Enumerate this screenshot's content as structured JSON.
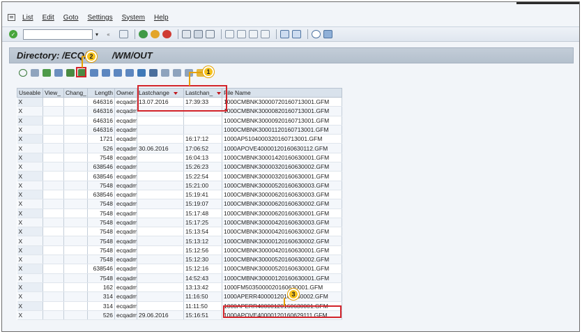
{
  "menu": [
    "List",
    "Edit",
    "Goto",
    "Settings",
    "System",
    "Help"
  ],
  "title": "Directory: /ECQ/10",
  "title_tail": "/WM/OUT",
  "callouts": {
    "one": "1",
    "two": "2",
    "three": "3"
  },
  "columns": [
    "Useable",
    "View_",
    "Chang_",
    "Length",
    "Owner",
    "Lastchange",
    "Lastchan_",
    "File Name"
  ],
  "rows": [
    {
      "useable": "X",
      "length": "646316",
      "owner": "ecqadm",
      "date": "13.07.2016",
      "time": "17:39:33",
      "file": "1000CMBNK30000720160713001.GFM"
    },
    {
      "useable": "X",
      "length": "646316",
      "owner": "ecqadm",
      "date": "",
      "time": "",
      "file": "1000CMBNK30000820160713001.GFM"
    },
    {
      "useable": "X",
      "length": "646316",
      "owner": "ecqadm",
      "date": "",
      "time": "",
      "file": "1000CMBNK30000920160713001.GFM"
    },
    {
      "useable": "X",
      "length": "646316",
      "owner": "ecqadm",
      "date": "",
      "time": "",
      "file": "1000CMBNK30001120160713001.GFM"
    },
    {
      "useable": "X",
      "length": "1721",
      "owner": "ecqadm",
      "date": "",
      "time": "16:17:12",
      "file": "1000AP5104000320160713001.GFM"
    },
    {
      "useable": "X",
      "length": "526",
      "owner": "ecqadm",
      "date": "30.06.2016",
      "time": "17:06:52",
      "file": "1000APOVE40000120160630112.GFM"
    },
    {
      "useable": "X",
      "length": "7548",
      "owner": "ecqadm",
      "date": "",
      "time": "16:04:13",
      "file": "1000CMBNK30001420160630001.GFM"
    },
    {
      "useable": "X",
      "length": "638546",
      "owner": "ecqadm",
      "date": "",
      "time": "15:26:23",
      "file": "1000CMBNK30000320160630002.GFM"
    },
    {
      "useable": "X",
      "length": "638546",
      "owner": "ecqadm",
      "date": "",
      "time": "15:22:54",
      "file": "1000CMBNK30000320160630001.GFM"
    },
    {
      "useable": "X",
      "length": "7548",
      "owner": "ecqadm",
      "date": "",
      "time": "15:21:00",
      "file": "1000CMBNK30000520160630003.GFM"
    },
    {
      "useable": "X",
      "length": "638546",
      "owner": "ecqadm",
      "date": "",
      "time": "15:19:41",
      "file": "1000CMBNK30000620160630003.GFM"
    },
    {
      "useable": "X",
      "length": "7548",
      "owner": "ecqadm",
      "date": "",
      "time": "15:19:07",
      "file": "1000CMBNK30000620160630002.GFM"
    },
    {
      "useable": "X",
      "length": "7548",
      "owner": "ecqadm",
      "date": "",
      "time": "15:17:48",
      "file": "1000CMBNK30000620160630001.GFM"
    },
    {
      "useable": "X",
      "length": "7548",
      "owner": "ecqadm",
      "date": "",
      "time": "15:17:25",
      "file": "1000CMBNK30000420160630003.GFM"
    },
    {
      "useable": "X",
      "length": "7548",
      "owner": "ecqadm",
      "date": "",
      "time": "15:13:54",
      "file": "1000CMBNK30000420160630002.GFM"
    },
    {
      "useable": "X",
      "length": "7548",
      "owner": "ecqadm",
      "date": "",
      "time": "15:13:12",
      "file": "1000CMBNK30000120160630002.GFM"
    },
    {
      "useable": "X",
      "length": "7548",
      "owner": "ecqadm",
      "date": "",
      "time": "15:12:56",
      "file": "1000CMBNK30000420160630001.GFM"
    },
    {
      "useable": "X",
      "length": "7548",
      "owner": "ecqadm",
      "date": "",
      "time": "15:12:30",
      "file": "1000CMBNK30000520160630002.GFM"
    },
    {
      "useable": "X",
      "length": "638546",
      "owner": "ecqadm",
      "date": "",
      "time": "15:12:16",
      "file": "1000CMBNK30000520160630001.GFM"
    },
    {
      "useable": "X",
      "length": "7548",
      "owner": "ecqadm",
      "date": "",
      "time": "14:52:43",
      "file": "1000CMBNK30000120160630001.GFM"
    },
    {
      "useable": "X",
      "length": "162",
      "owner": "ecqadm",
      "date": "",
      "time": "13:13:42",
      "file": "1000FM5035000020160630001.GFM"
    },
    {
      "useable": "X",
      "length": "314",
      "owner": "ecqadm",
      "date": "",
      "time": "11:16:50",
      "file": "1000APERR40000120160630002.GFM"
    },
    {
      "useable": "X",
      "length": "314",
      "owner": "ecqadm",
      "date": "",
      "time": "11:11:50",
      "file": "1000APERR40000120160630001.GFM"
    },
    {
      "useable": "X",
      "length": "526",
      "owner": "ecqadm",
      "date": "29.06.2016",
      "time": "15:16:51",
      "file": "1000APOVE40000120160629111.GFM"
    }
  ],
  "colors": {
    "highlight": "#d3232a",
    "callout": "#f6c21b",
    "title_bg": "#b9c4d1"
  },
  "toolbar_icons": [
    "refresh",
    "detail",
    "sort-ascending",
    "sort-descending",
    "filter",
    "sum",
    "print",
    "export",
    "layout",
    "grid",
    "find",
    "select-all"
  ]
}
